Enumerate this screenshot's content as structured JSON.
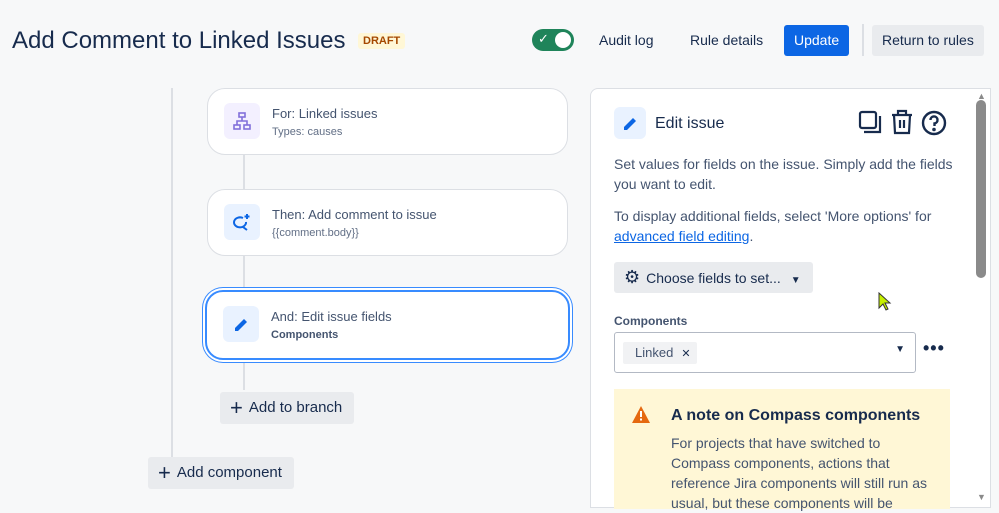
{
  "header": {
    "title": "Add Comment to Linked Issues",
    "badge": "DRAFT",
    "toggle_on": true,
    "audit_log": "Audit log",
    "rule_details": "Rule details",
    "update": "Update",
    "return": "Return to rules"
  },
  "flow": {
    "cards": [
      {
        "title": "For: Linked issues",
        "subtitle": "Types: causes",
        "icon": "hierarchy-icon"
      },
      {
        "title": "Then: Add comment to issue",
        "subtitle": "{{comment.body}}",
        "icon": "comment-add-icon"
      },
      {
        "title": "And: Edit issue fields",
        "subtitle": "Components",
        "icon": "pencil-icon"
      }
    ],
    "add_branch": "Add to branch",
    "add_component": "Add component"
  },
  "panel": {
    "title": "Edit issue",
    "desc": "Set values for fields on the issue. Simply add the fields you want to edit.",
    "desc2": "To display additional fields, select 'More options' for ",
    "link": "advanced field editing",
    "choose": "Choose fields to set...",
    "field_label": "Components",
    "tag": "Linked",
    "note": {
      "title": "A note on Compass components",
      "body": "For projects that have switched to Compass components, actions that reference Jira components will still run as usual, but these components will be"
    }
  }
}
